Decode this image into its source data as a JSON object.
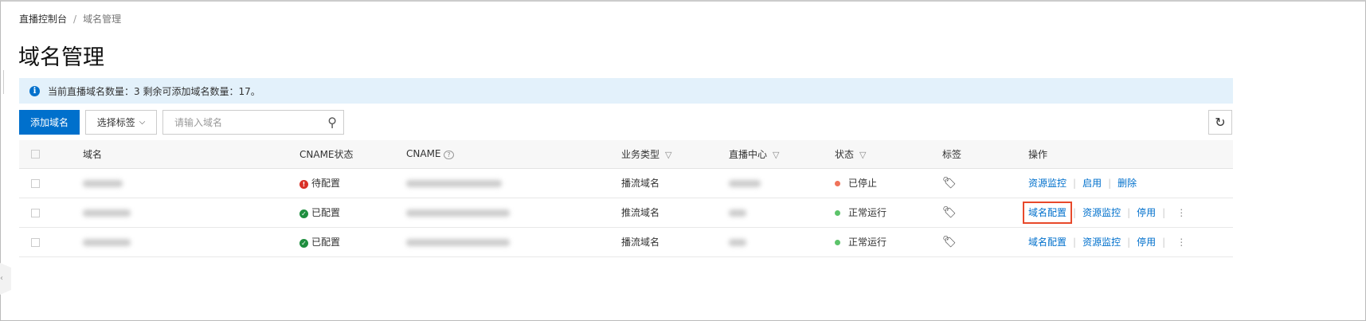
{
  "breadcrumb": {
    "root": "直播控制台",
    "separator": "/",
    "current": "域名管理"
  },
  "page_title": "域名管理",
  "info": "当前直播域名数量：3 剩余可添加域名数量：17。",
  "toolbar": {
    "add_label": "添加域名",
    "tag_select_label": "选择标签",
    "search_placeholder": "请输入域名"
  },
  "table": {
    "headers": [
      "域名",
      "CNAME状态",
      "CNAME",
      "业务类型",
      "直播中心",
      "状态",
      "标签",
      "操作"
    ],
    "rows": [
      {
        "cname_status": "待配置",
        "cname_status_type": "warning",
        "biz_type": "播流域名",
        "status": "已停止",
        "status_color": "#f0735a",
        "actions": [
          "资源监控",
          "启用",
          "删除"
        ],
        "more": false
      },
      {
        "cname_status": "已配置",
        "cname_status_type": "ok",
        "biz_type": "推流域名",
        "status": "正常运行",
        "status_color": "#5cc36a",
        "actions": [
          "域名配置",
          "资源监控",
          "停用"
        ],
        "more": true
      },
      {
        "cname_status": "已配置",
        "cname_status_type": "ok",
        "biz_type": "播流域名",
        "status": "正常运行",
        "status_color": "#5cc36a",
        "actions": [
          "域名配置",
          "资源监控",
          "停用"
        ],
        "more": true
      }
    ]
  }
}
